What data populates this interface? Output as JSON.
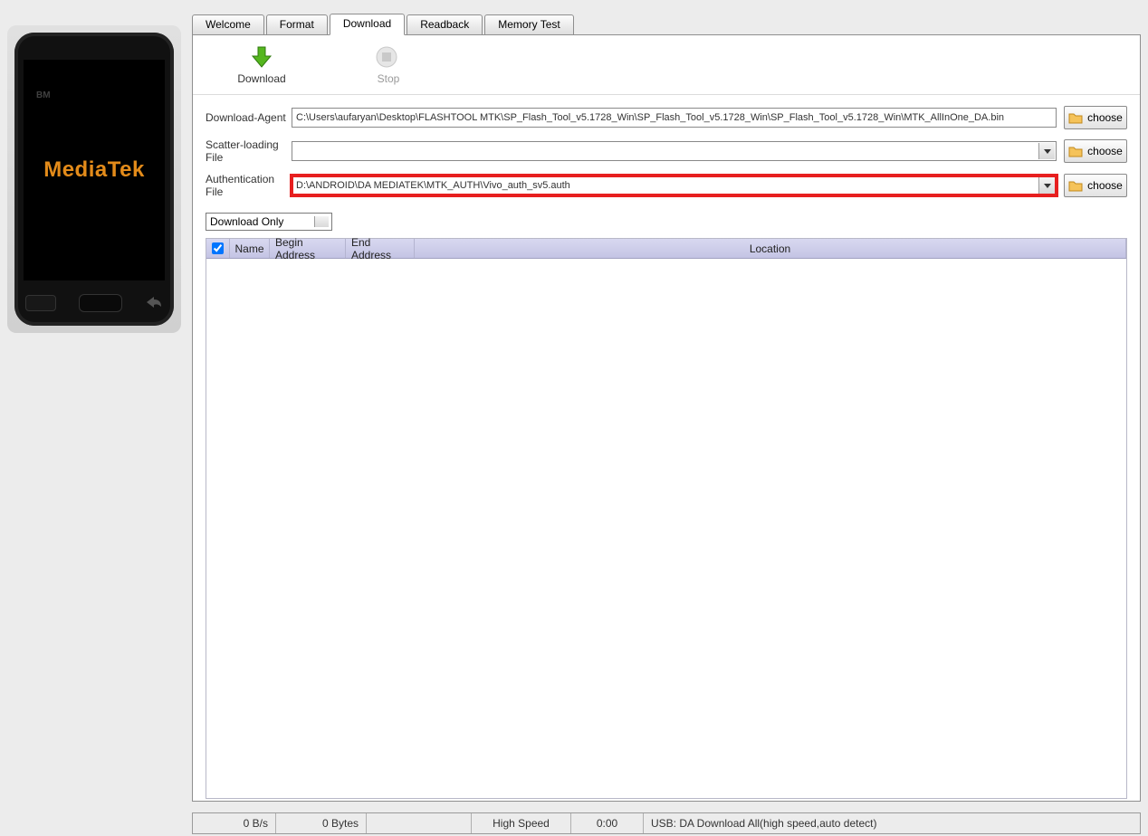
{
  "phone": {
    "brand": "MediaTek",
    "bm": "BM"
  },
  "tabs": [
    {
      "label": "Welcome",
      "active": false
    },
    {
      "label": "Format",
      "active": false
    },
    {
      "label": "Download",
      "active": true
    },
    {
      "label": "Readback",
      "active": false
    },
    {
      "label": "Memory Test",
      "active": false
    }
  ],
  "toolbar": {
    "download_label": "Download",
    "stop_label": "Stop"
  },
  "form": {
    "da_label": "Download-Agent",
    "da_value": "C:\\Users\\aufaryan\\Desktop\\FLASHTOOL MTK\\SP_Flash_Tool_v5.1728_Win\\SP_Flash_Tool_v5.1728_Win\\SP_Flash_Tool_v5.1728_Win\\MTK_AllInOne_DA.bin",
    "scatter_label": "Scatter-loading File",
    "scatter_value": "",
    "auth_label": "Authentication File",
    "auth_value": "D:\\ANDROID\\DA MEDIATEK\\MTK_AUTH\\Vivo_auth_sv5.auth",
    "choose_label": "choose",
    "mode_value": "Download Only"
  },
  "grid": {
    "col_name": "Name",
    "col_begin": "Begin Address",
    "col_end": "End Address",
    "col_location": "Location"
  },
  "status": {
    "rate": "0 B/s",
    "bytes": "0 Bytes",
    "speed": "High Speed",
    "time": "0:00",
    "usb": "USB: DA Download All(high speed,auto detect)"
  }
}
